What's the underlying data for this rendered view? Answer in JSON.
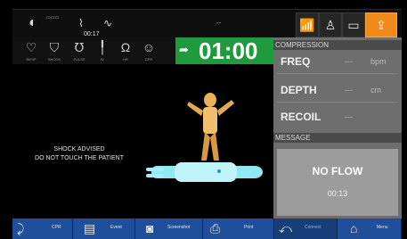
{
  "topbar": {
    "elapsed_time": "00:17",
    "center": "--",
    "icons": [
      "volume-icon",
      "record-icon",
      "ecg-icon",
      "wifi-icon",
      "person-icon",
      "battery-icon",
      "export-icon"
    ]
  },
  "vitals": {
    "icons": [
      "heart-icon",
      "lung-icon",
      "pulse-icon",
      "syringe-icon",
      "stethoscope-icon",
      "face-icon"
    ],
    "labels": [
      "RESP",
      "SHOCK",
      "PULSE",
      "IV",
      "HR",
      "CPR"
    ]
  },
  "timer": {
    "value": "01:00"
  },
  "right_panel": {
    "compression_header": "COMPRESSION",
    "freq_label": "FREQ",
    "freq_value": "---",
    "freq_unit": "bpm",
    "depth_label": "DEPTH",
    "depth_value": "---",
    "depth_unit": "cm",
    "recoil_label": "RECOIL",
    "recoil_value": "---",
    "message_header": "MESSAGE",
    "message_text": "NO FLOW",
    "message_time": "00:13"
  },
  "main": {
    "shock_line1": "SHOCK ADVISED",
    "shock_line2": "DO NOT TOUCH THE PATIENT"
  },
  "bottom_bar": {
    "items": [
      {
        "label": "CPR",
        "icon": "cpr-icon"
      },
      {
        "label": "Event",
        "icon": "list-icon"
      },
      {
        "label": "Screenshot",
        "icon": "camera-icon"
      },
      {
        "label": "Print",
        "icon": "print-icon"
      },
      {
        "label": "Connect",
        "icon": "connect-icon"
      },
      {
        "label": "Menu",
        "icon": "home-icon"
      }
    ]
  },
  "colors": {
    "timer_green": "#1f9a3c",
    "panel_gray": "#6e6e6e",
    "accent_orange": "#f08a1a",
    "bottom_blue": "#1e4f98"
  }
}
